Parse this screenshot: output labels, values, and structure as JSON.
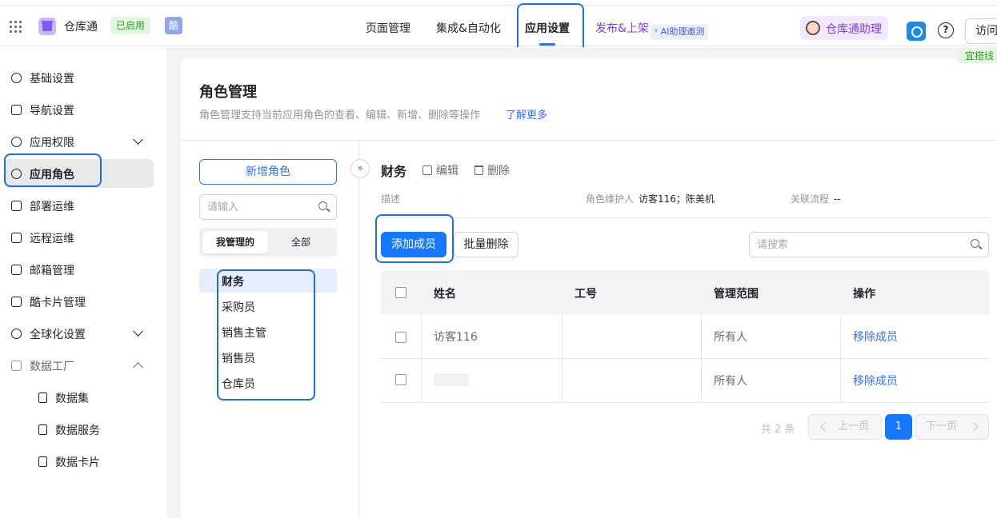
{
  "topbar": {
    "app_name": "仓库通",
    "status": "已启用",
    "ku_badge": "酷",
    "tabs": [
      "页面管理",
      "集成&自动化",
      "应用设置"
    ],
    "active_tab": "应用设置",
    "publish": "发布&上架",
    "ai_tag": "ᵞ AI助理邀测",
    "assistant": "仓库通助理",
    "help": "?",
    "visit": "访问",
    "corner_tag": "宜搭线",
    "accent_color": "#3370ff"
  },
  "sidebar": {
    "items": [
      {
        "label": "基础设置",
        "icon": "gear-icon"
      },
      {
        "label": "导航设置",
        "icon": "list-icon"
      },
      {
        "label": "应用权限",
        "icon": "user-lock-icon"
      },
      {
        "label": "应用角色",
        "icon": "user-icon"
      },
      {
        "label": "部署运维",
        "icon": "deploy-icon"
      },
      {
        "label": "远程运维",
        "icon": "monitor-icon"
      },
      {
        "label": "邮箱管理",
        "icon": "mail-icon"
      },
      {
        "label": "酷卡片管理",
        "icon": "card-icon"
      },
      {
        "label": "全球化设置",
        "icon": "globe-icon"
      },
      {
        "label": "数据工厂",
        "icon": "database-icon"
      }
    ],
    "sub_items": [
      {
        "label": "数据集",
        "icon": "dataset-icon"
      },
      {
        "label": "数据服务",
        "icon": "data-service-icon"
      },
      {
        "label": "数据卡片",
        "icon": "data-card-icon"
      }
    ],
    "active": "应用角色"
  },
  "page": {
    "title": "角色管理",
    "desc": "角色管理支持当前应用角色的查看、编辑、新增、删除等操作",
    "learn_more": "了解更多"
  },
  "roles": {
    "add_button": "新增角色",
    "search_placeholder": "请输入",
    "segments": [
      "我管理的",
      "全部"
    ],
    "list": [
      "财务",
      "采购员",
      "销售主管",
      "销售员",
      "仓库员"
    ],
    "selected": "财务"
  },
  "detail": {
    "collapse": "»",
    "role_name": "财务",
    "edit": "编辑",
    "delete": "删除",
    "desc_key": "描述",
    "maintainer_key": "角色维护人",
    "maintainer_val": "访客116；陈美机",
    "flow_key": "关联流程",
    "flow_val": "--",
    "add_member": "添加成员",
    "bulk_delete": "批量删除",
    "search_placeholder": "请搜索"
  },
  "table": {
    "headers": [
      "姓名",
      "工号",
      "管理范围",
      "操作"
    ],
    "rows": [
      {
        "name": "访客116",
        "id": "",
        "scope": "所有人",
        "action": "移除成员"
      },
      {
        "name": "",
        "id": "",
        "scope": "所有人",
        "action": "移除成员"
      }
    ]
  },
  "pagination": {
    "total": "共 2 条",
    "prev": "上一页",
    "current": "1",
    "next": "下一页"
  }
}
